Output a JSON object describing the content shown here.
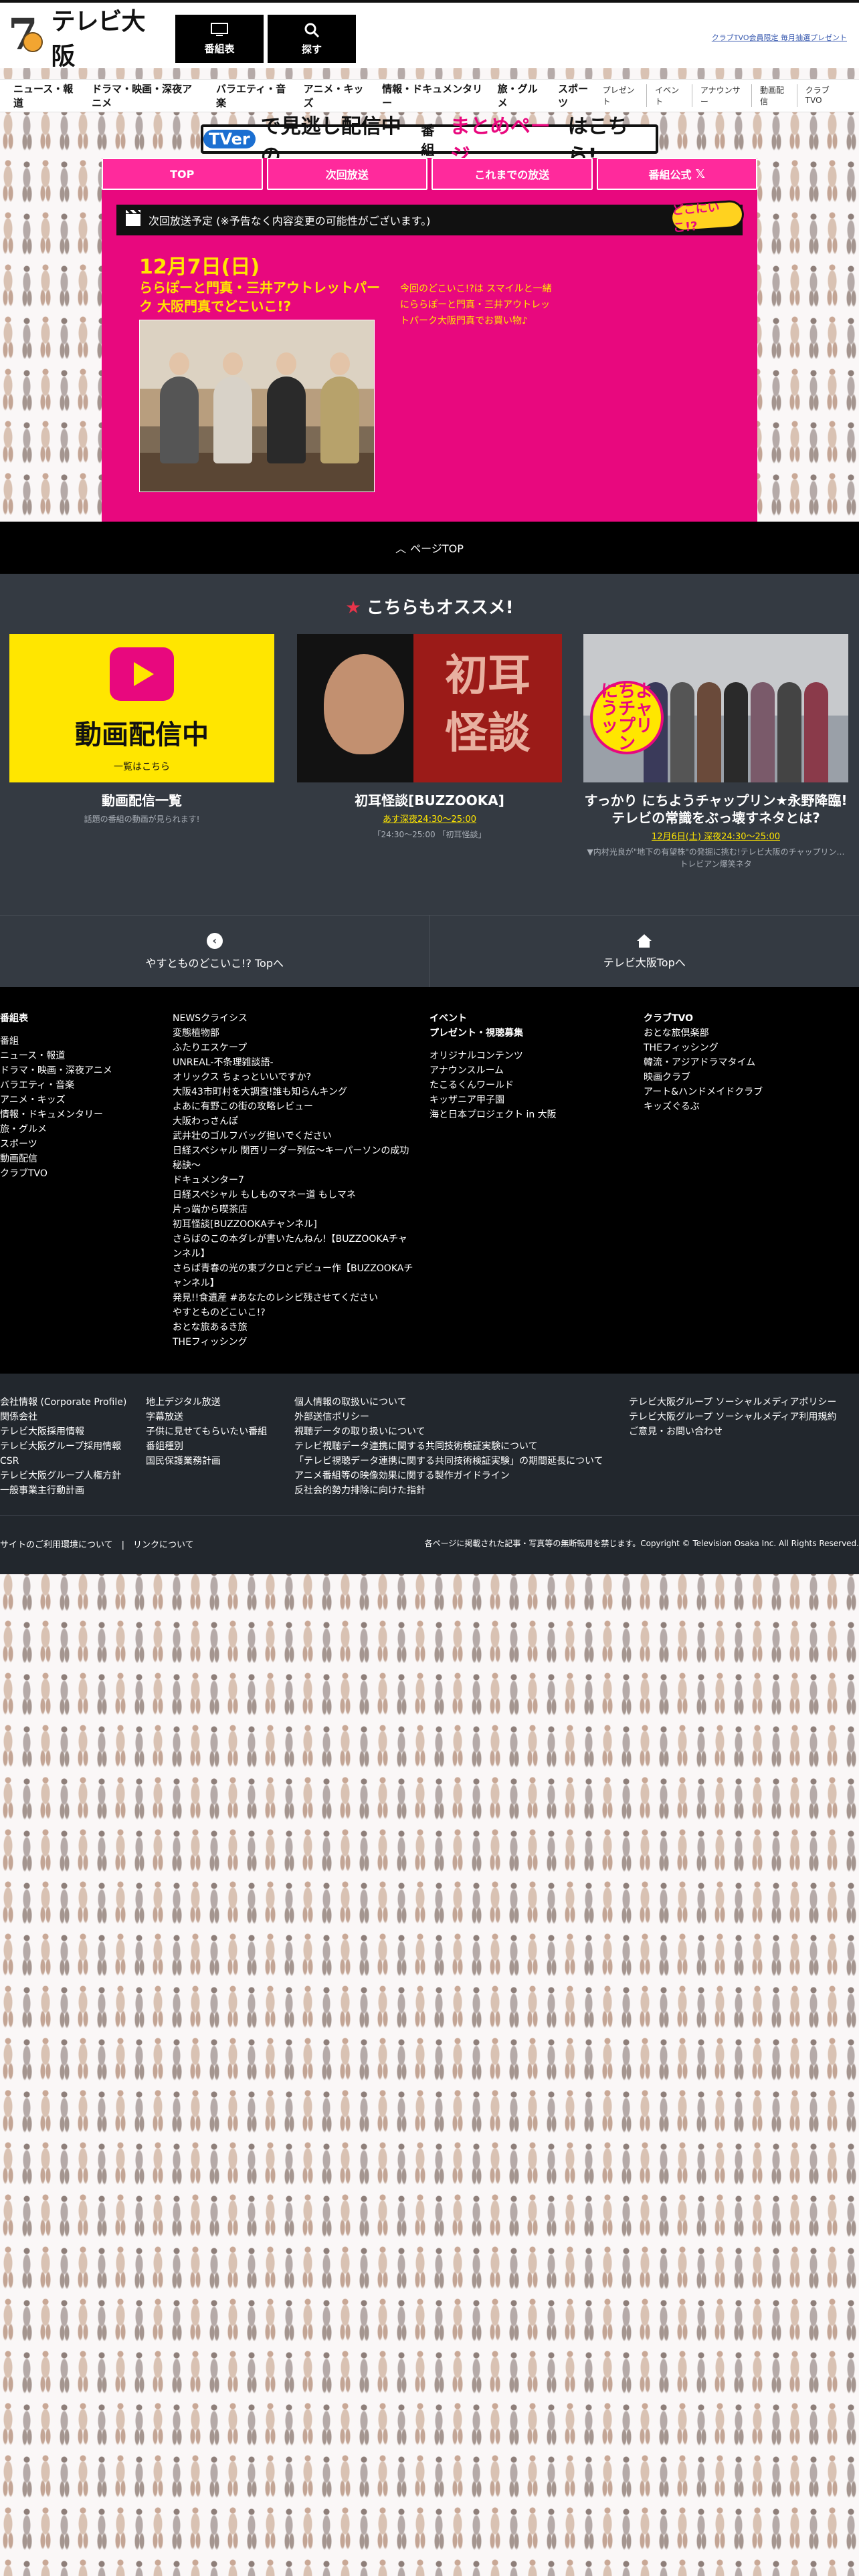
{
  "header": {
    "promo_link": "クラブTVO会員限定 毎月抽選プレゼント",
    "btn_schedule": "番組表",
    "btn_search": "探す",
    "logo": "テレビ大阪"
  },
  "nav": {
    "main": [
      "ニュース・報道",
      "ドラマ・映画・深夜アニメ",
      "バラエティ・音楽",
      "アニメ・キッズ",
      "情報・ドキュメンタリー",
      "旅・グルメ",
      "スポーツ"
    ],
    "sub": [
      "プレゼント",
      "イベント",
      "アナウンサー",
      "動画配信",
      "クラブTVO"
    ]
  },
  "tver_banner": {
    "logo": "TVer",
    "t1": "で見逃し配信中の",
    "t2": "番組",
    "t3": "まとめページ",
    "t4": "はこちら!"
  },
  "tabs": [
    "TOP",
    "次回放送",
    "これまでの放送",
    "番組公式"
  ],
  "next": {
    "bar_label": "次回放送予定 (※予告なく内容変更の可能性がございます。)",
    "badge": "どこにいこ!?",
    "date": "12月7日(日)",
    "title": "ららぽーと門真・三井アウトレットパーク 大阪門真でどこいこ!?",
    "description": "今回のどこいこ!?は スマイルと一緒にららぽーと門真・三井アウトレットパーク大阪門真でお買い物♪"
  },
  "pagetop": "ページTOP",
  "recommend": {
    "title": "こちらもオススメ!",
    "cards": [
      {
        "title": "動画配信一覧",
        "sub": "話題の番組の動画が見られます!",
        "time": "",
        "note": "",
        "thumb_big": "動画配信中",
        "thumb_small": "一覧はこちら"
      },
      {
        "title": "初耳怪談[BUZZOOKA]",
        "sub": "",
        "time": "あす深夜24:30～25:00",
        "note": "「24:30～25:00 「初耳怪談」",
        "thumb_big": "初耳怪談",
        "thumb_small": ""
      },
      {
        "title": "すっかり にちようチャップリン★永野降臨! テレビの常識をぶっ壊すネタとは?",
        "sub": "",
        "time": "12月6日(土) 深夜24:30～25:00",
        "note": "▼内村光良が\"地下の有望株\"の発掘に挑む!テレビ大阪のチャップリン…トレビアン爆笑ネタ",
        "thumb_big": "にちようチャップリン",
        "thumb_small": ""
      }
    ]
  },
  "bottom_links": {
    "left": "やすとものどこいこ!? Topへ",
    "right": "テレビ大阪Topへ"
  },
  "footer": {
    "col1_head": "番組表",
    "col1": [
      "番組",
      "ニュース・報道",
      "ドラマ・映画・深夜アニメ",
      "バラエティ・音楽",
      "アニメ・キッズ",
      "情報・ドキュメンタリー",
      "旅・グルメ",
      "スポーツ",
      "動画配信",
      "クラブTVO"
    ],
    "col2": [
      "NEWSクライシス",
      "変態植物部",
      "ふたりエスケープ",
      "UNREAL-不条理雑談語-",
      "オリックス ちょっといいですか?",
      "大阪43市町村を大調査!誰も知らんキング",
      "よあに有野この街の攻略レビュー",
      "大阪わっさんぽ",
      "武井壮のゴルフバッグ担いでください",
      "日経スペシャル 関西リーダー列伝～キーパーソンの成功秘訣～",
      "ドキュメンター7",
      "日経スペシャル もしものマネー道 もしマネ",
      "片っ端から喫茶店",
      "初耳怪談[BUZZOOKAチャンネル]",
      "さらばのこの本ダレが書いたんねん!【BUZZOOKAチャンネル】",
      "さらば青春の光の東ブクロとデビュー作【BUZZOOKAチャンネル】",
      "発見!!食遺産 #あなたのレシピ残させてください",
      "やすとものどこいこ!?",
      "おとな旅あるき旅",
      "THEフィッシング"
    ],
    "col3_head1": "イベント",
    "col3_head2": "プレゼント・視聴募集",
    "col3": [
      "オリジナルコンテンツ",
      "アナウンスルーム",
      "たこるくんワールド",
      "キッザニア甲子園",
      "海と日本プロジェクト in 大阪"
    ],
    "col4_head": "クラブTVO",
    "col4": [
      "おとな旅倶楽部",
      "THEフィッシング",
      "韓流・アジアドラマタイム",
      "映画クラブ",
      "アート&ハンドメイドクラブ",
      "キッズぐるぶ"
    ]
  },
  "corp": {
    "col1": [
      "会社情報 (Corporate Profile)",
      "関係会社",
      "テレビ大阪採用情報",
      "テレビ大阪グループ採用情報",
      "CSR",
      "テレビ大阪グループ人権方針",
      "一般事業主行動計画"
    ],
    "col2": [
      "地上デジタル放送",
      "字幕放送",
      "子供に見せてもらいたい番組",
      "番組種別",
      "国民保護業務計画"
    ],
    "col3": [
      "個人情報の取扱いについて",
      "外部送信ポリシー",
      "視聴データの取り扱いについて",
      "テレビ視聴データ連携に関する共同技術検証実験について",
      "「テレビ視聴データ連携に関する共同技術検証実験」の期間延長について",
      "アニメ番組等の映像効果に関する製作ガイドライン",
      "反社会的勢力排除に向けた指針"
    ],
    "col4": [
      "テレビ大阪グループ ソーシャルメディアポリシー",
      "テレビ大阪グループ ソーシャルメディア利用規約",
      "ご意見・お問い合わせ"
    ],
    "bottom_left": "サイトのご利用環境について　|　リンクについて",
    "bottom_right": "各ページに掲載された記事・写真等の無断転用を禁じます。Copyright © Television Osaka Inc. All Rights Reserved."
  },
  "colors": {
    "brand_pink": "#e8087e",
    "accent_yellow": "#ffe600",
    "dark": "#343a42"
  }
}
